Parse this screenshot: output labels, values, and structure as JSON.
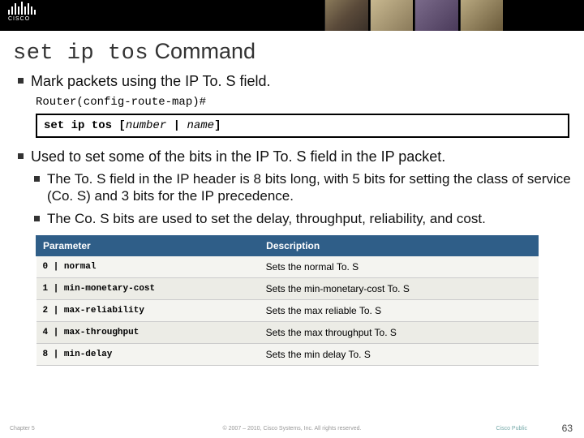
{
  "logo_text": "CISCO",
  "title_mono": "set ip tos",
  "title_rest": " Command",
  "bullets": {
    "b1": "Mark packets using the IP To. S field.",
    "prompt": "Router(config-route-map)#",
    "syntax_cmd": "set ip tos ",
    "syntax_args_open": "[",
    "syntax_arg1": "number",
    "syntax_pipe": " | ",
    "syntax_arg2": "name",
    "syntax_args_close": "]",
    "b2": "Used to set some of the bits in the IP To. S field in the IP packet.",
    "b2a": "The To. S field in the IP header is 8 bits long, with 5 bits for setting the class of service (Co. S) and 3 bits for the IP precedence.",
    "b2b": "The Co. S bits are used to set the delay, throughput, reliability, and cost."
  },
  "table": {
    "h1": "Parameter",
    "h2": "Description",
    "rows": [
      {
        "p": "0 | normal",
        "d": "Sets the normal To. S"
      },
      {
        "p": "1 | min-monetary-cost",
        "d": "Sets the min-monetary-cost To. S"
      },
      {
        "p": "2 | max-reliability",
        "d": "Sets the max reliable To. S"
      },
      {
        "p": "4 | max-throughput",
        "d": "Sets the max throughput To. S"
      },
      {
        "p": "8 | min-delay",
        "d": "Sets the min delay To. S"
      }
    ]
  },
  "footer": {
    "chapter": "Chapter 5",
    "copyright": "© 2007 – 2010, Cisco Systems, Inc. All rights reserved.",
    "public": "Cisco Public",
    "page": "63"
  }
}
